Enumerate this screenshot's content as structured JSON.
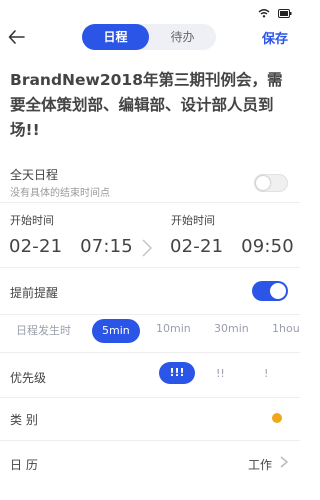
{
  "header": {
    "tabs": [
      {
        "label": "日程",
        "active": true
      },
      {
        "label": "待办",
        "active": false
      }
    ],
    "save_label": "保存"
  },
  "event": {
    "title": "BrandNew2018年第三期刊例会，需要全体策划部、编辑部、设计部人员到场!!"
  },
  "all_day": {
    "label": "全天日程",
    "hint": "没有具体的结束时间点",
    "enabled": false
  },
  "time": {
    "start_label": "开始时间",
    "start_value": "02-21   07:15",
    "end_label": "开始时间",
    "end_value": "02-21   09:50"
  },
  "reminder": {
    "label": "提前提醒",
    "enabled": true,
    "options": [
      "日程发生时",
      "5min",
      "10min",
      "30min",
      "1hou"
    ],
    "selected": "5min"
  },
  "priority": {
    "label": "优先级",
    "options": [
      "!!!",
      "!!",
      "!"
    ],
    "selected": "!!!"
  },
  "category": {
    "label": "类 别",
    "color": "#f0a71b"
  },
  "calendar": {
    "label": "日 历",
    "value": "工作"
  },
  "colors": {
    "accent": "#2b55e7"
  }
}
